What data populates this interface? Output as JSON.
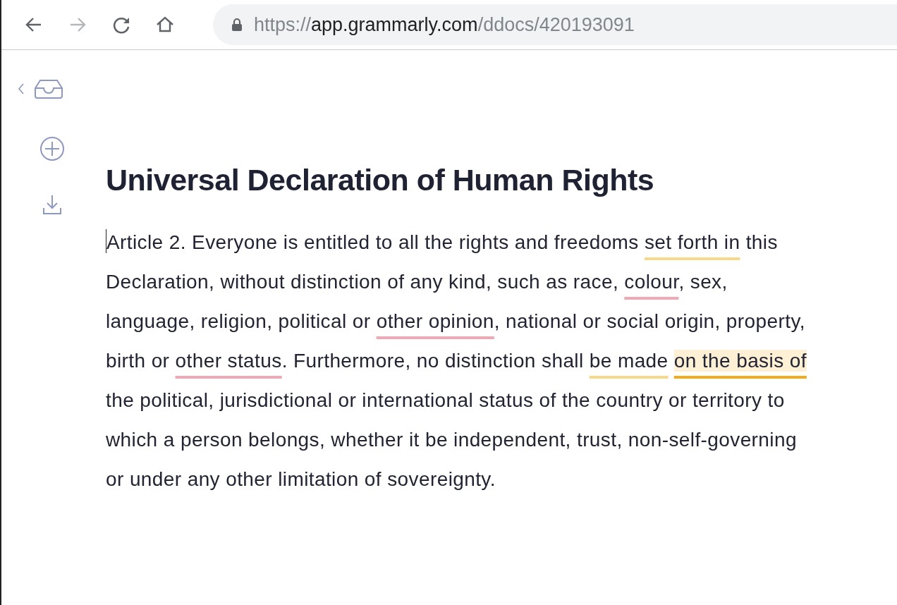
{
  "browser": {
    "back": {
      "disabled": false
    },
    "forward": {
      "disabled": true
    },
    "url": {
      "scheme": "https://",
      "host": "app.grammarly.com",
      "path": "/ddocs/420193091"
    }
  },
  "document": {
    "title": "Universal Declaration of Human Rights",
    "segments": [
      {
        "text": "Article 2. Everyone is entitled to all the rights and freedoms ",
        "kind": "plain"
      },
      {
        "text": "set forth in",
        "kind": "clarity"
      },
      {
        "text": " this Declaration, without distinction of any kind, such as race, ",
        "kind": "plain"
      },
      {
        "text": "colour",
        "kind": "correctness"
      },
      {
        "text": ", sex, language, religion, political or ",
        "kind": "plain"
      },
      {
        "text": "other opinion",
        "kind": "correctness"
      },
      {
        "text": ", national or social origin, property, birth or ",
        "kind": "plain"
      },
      {
        "text": "other status",
        "kind": "correctness"
      },
      {
        "text": ". Furthermore, no distinction shall ",
        "kind": "plain"
      },
      {
        "text": "be made",
        "kind": "clarity"
      },
      {
        "text": "on the basis of",
        "kind": "active",
        "space_before": true
      },
      {
        "text": " the political, jurisdictional or international status of the country or territory to which a person belongs, whether it be independent, trust, non-self-governing or under any other limitation of sovereignty.",
        "kind": "plain"
      }
    ]
  }
}
